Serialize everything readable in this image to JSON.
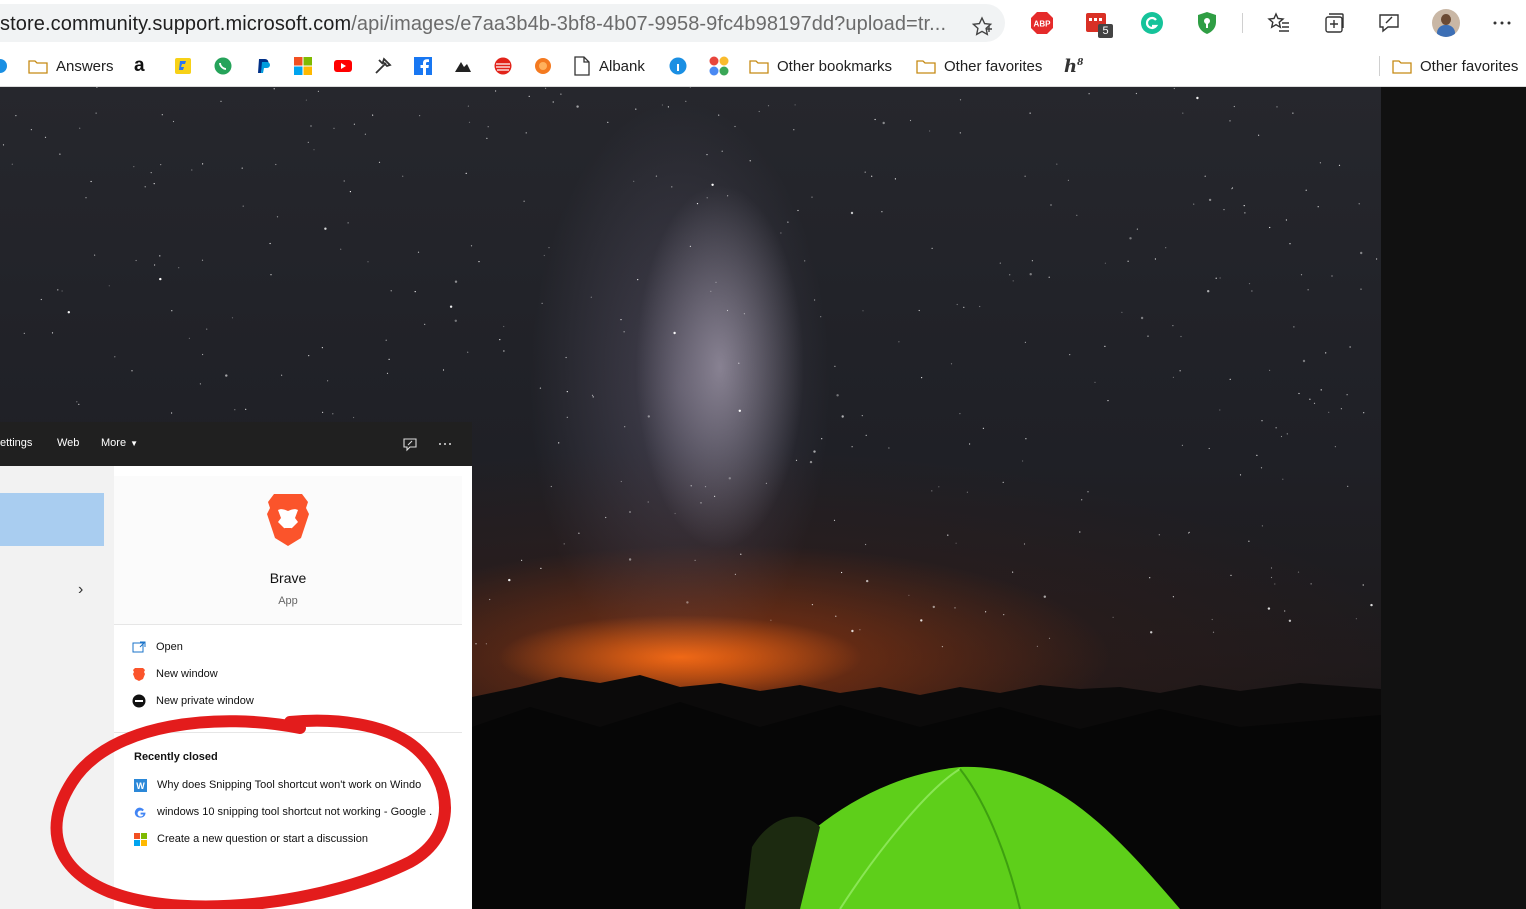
{
  "address_bar": {
    "url_host": "store.community.support.microsoft.com",
    "url_path": "/api/images/e7aa3b4b-3bf8-4b07-9958-9fc4b98197dd?upload=tr...",
    "extension_badge": "5"
  },
  "bookmarks": {
    "answers": "Answers",
    "albank": "Albank",
    "other_bookmarks": "Other bookmarks",
    "other_favorites_1": "Other favorites",
    "other_favorites_2": "Other favorites"
  },
  "start_menu": {
    "tabs": {
      "settings": "ettings",
      "web": "Web",
      "more": "More"
    },
    "app": {
      "name": "Brave",
      "type": "App"
    },
    "actions": {
      "open": "Open",
      "new_window": "New window",
      "new_private_window": "New private window"
    },
    "recently_closed": {
      "title": "Recently closed",
      "items": [
        "Why does Snipping Tool shortcut won't work on Windo",
        "windows 10 snipping tool shortcut not working - Google .",
        "Create a new question or start a discussion"
      ]
    }
  },
  "colors": {
    "accent_red": "#e31c1c",
    "brave_orange": "#fb542b",
    "tent_green": "#5ecf1a"
  }
}
